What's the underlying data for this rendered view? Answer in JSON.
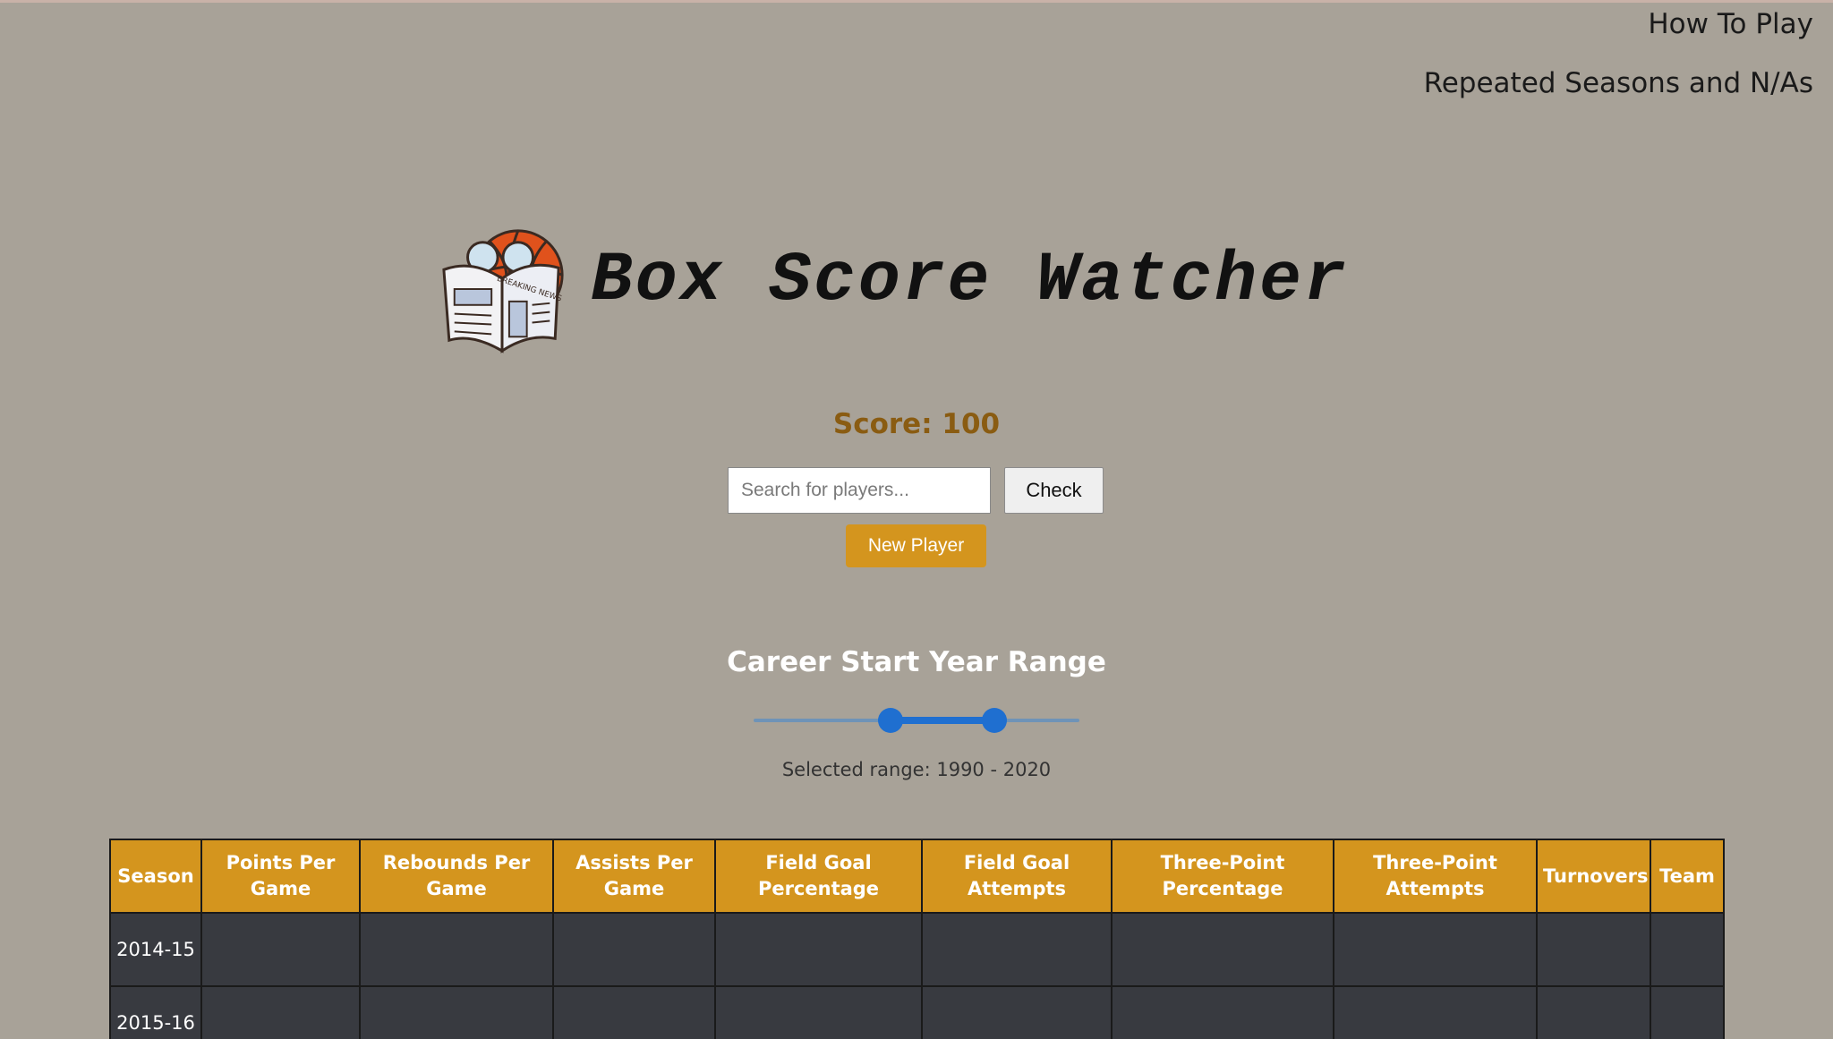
{
  "nav": {
    "how_to_play": "How To Play",
    "repeated_seasons": "Repeated Seasons and N/As"
  },
  "header": {
    "title": "Box Score Watcher",
    "logo_badge_text": "BREAKING NEWS"
  },
  "score": {
    "text": "Score: 100"
  },
  "search": {
    "placeholder": "Search for players...",
    "value": "",
    "check_label": "Check"
  },
  "new_player_label": "New Player",
  "range": {
    "title": "Career Start Year Range",
    "text": "Selected range: 1990 - 2020",
    "low_fraction": 0.42,
    "high_fraction": 0.74
  },
  "colors": {
    "background": "#a8a298",
    "accent": "#d4951e",
    "score": "#8a5c12",
    "slider": "#1f6fd0",
    "table_cell": "#383a40"
  },
  "table": {
    "headers": [
      "Season",
      "Points Per Game",
      "Rebounds Per Game",
      "Assists Per Game",
      "Field Goal Percentage",
      "Field Goal Attempts",
      "Three-Point Percentage",
      "Three-Point Attempts",
      "Turnovers",
      "Team"
    ],
    "rows": [
      {
        "season": "2014-15",
        "cells": [
          "",
          "",
          "",
          "",
          "",
          "",
          "",
          "",
          ""
        ]
      },
      {
        "season": "2015-16",
        "cells": [
          "",
          "",
          "",
          "",
          "",
          "",
          "",
          "",
          ""
        ]
      }
    ]
  }
}
